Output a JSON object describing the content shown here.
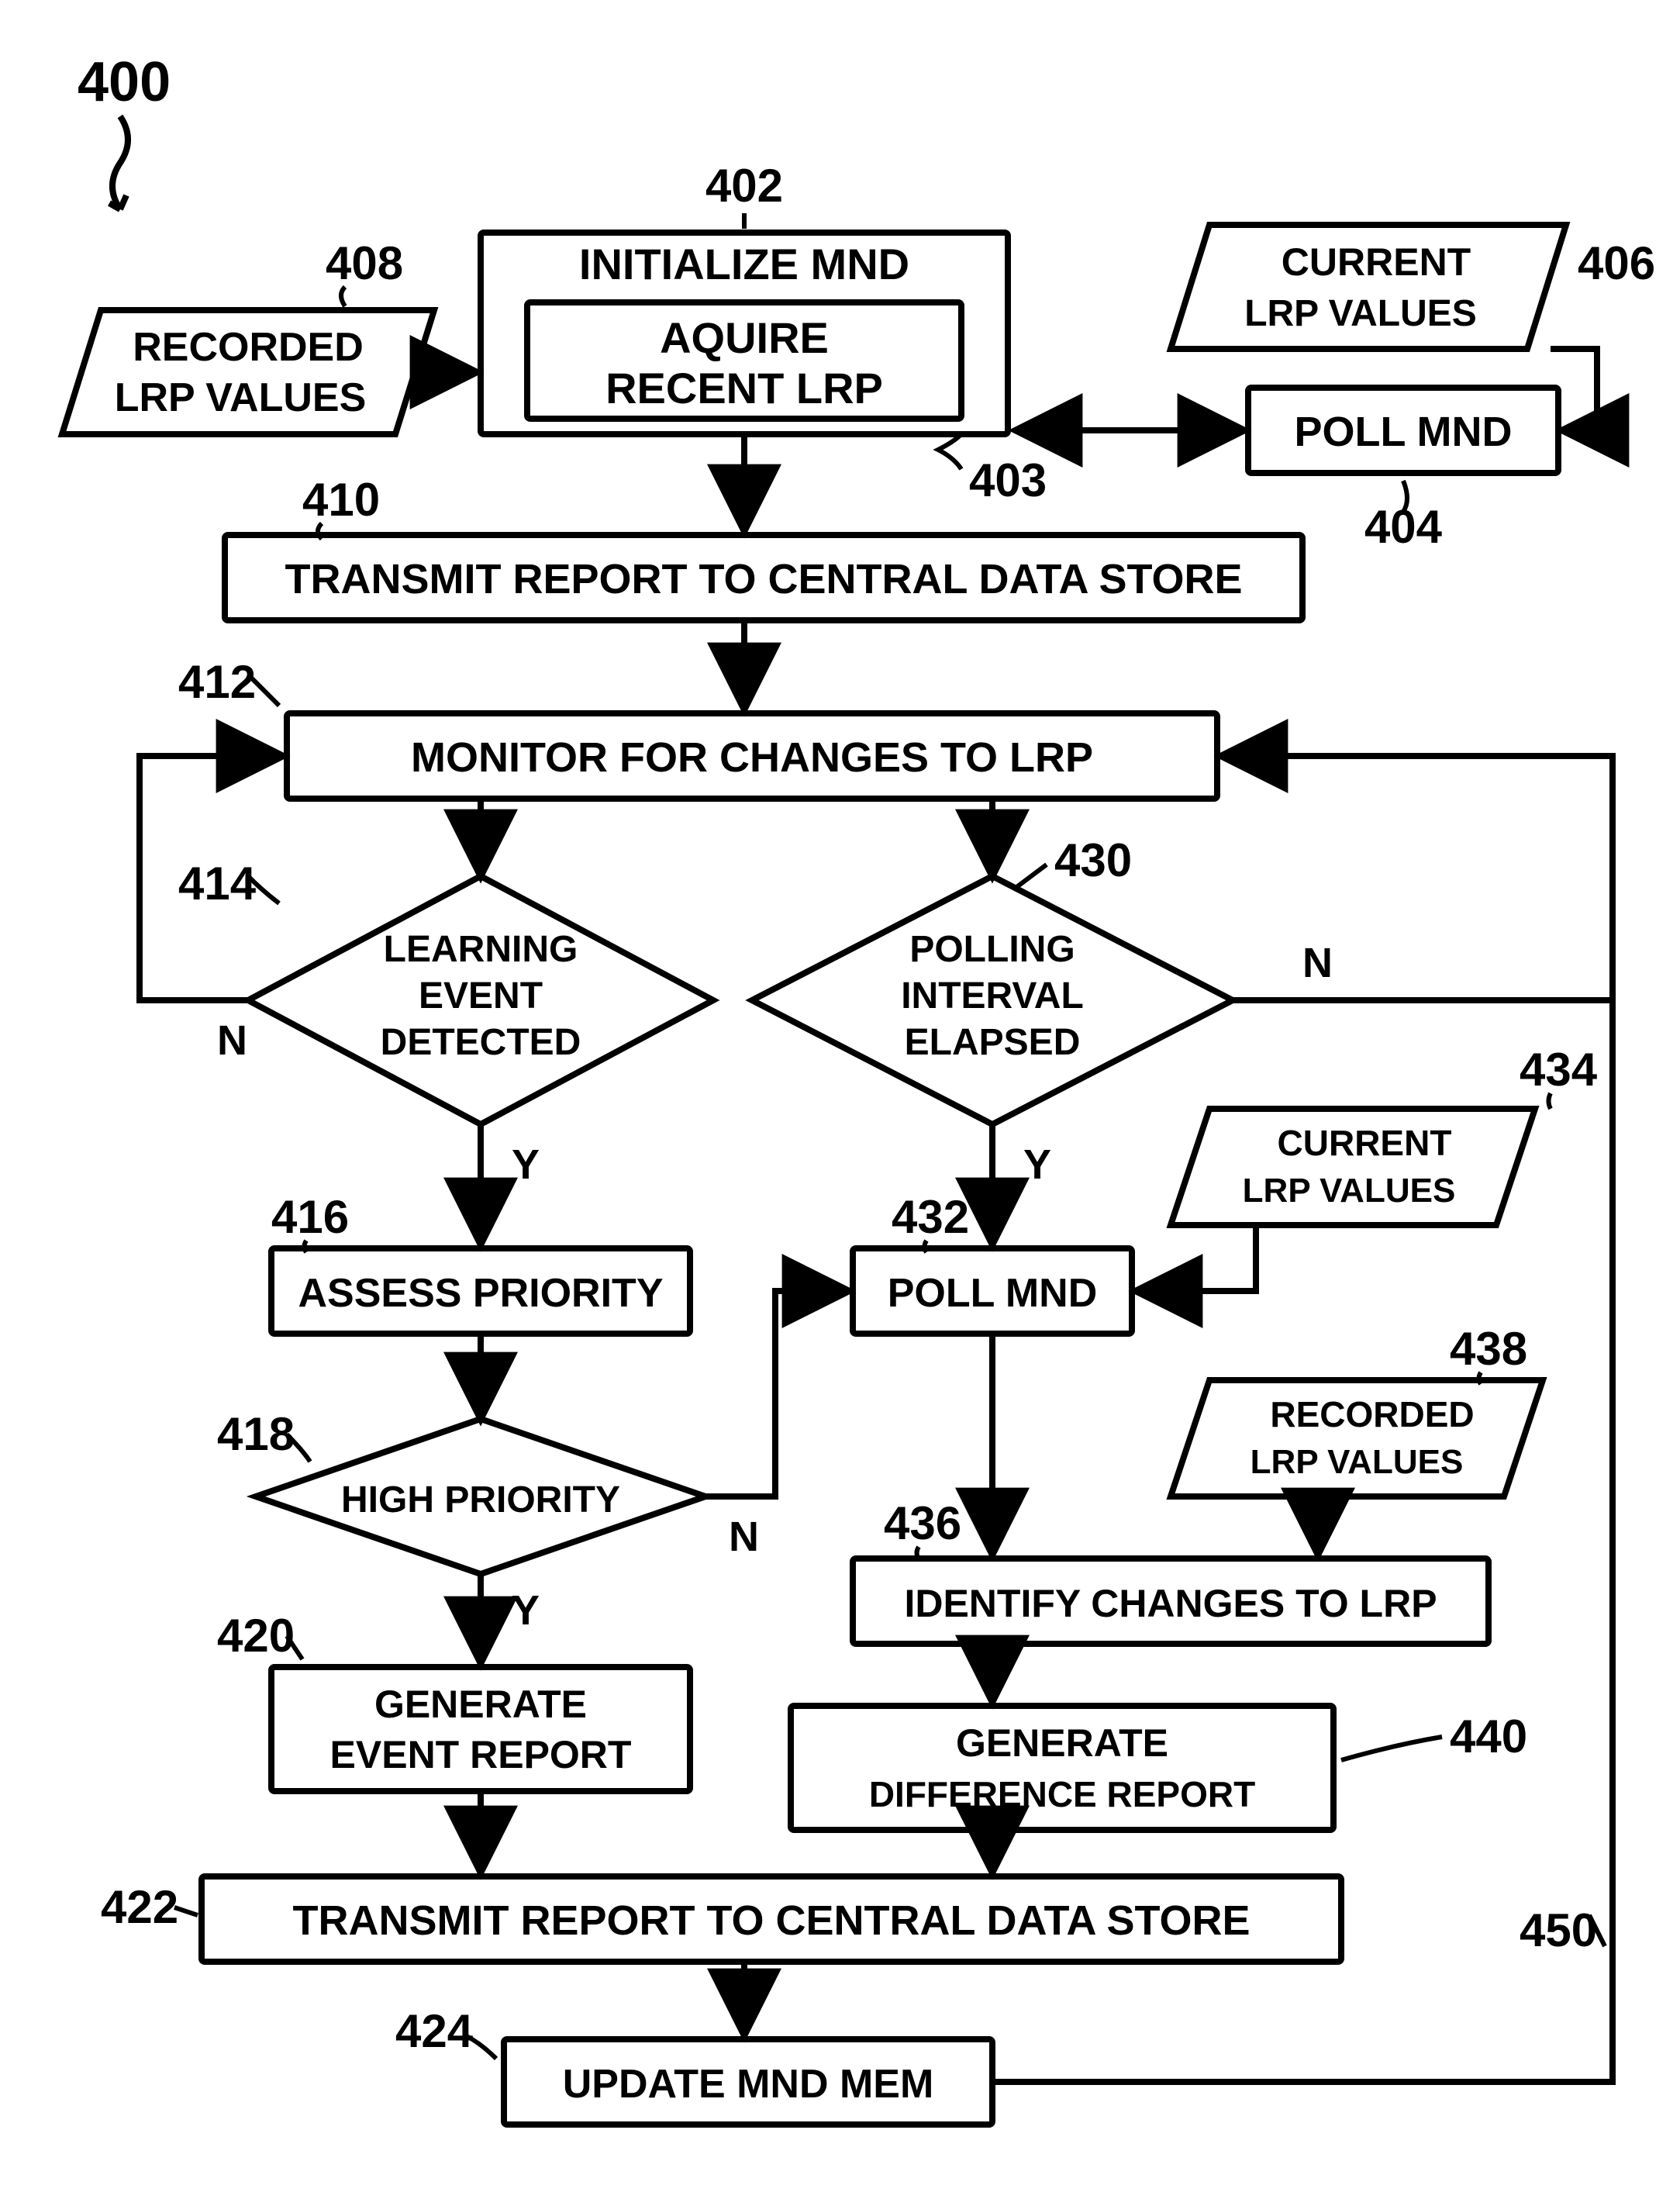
{
  "figureRef": "400",
  "nodes": {
    "n402": {
      "ref": "402",
      "label": "INITIALIZE MND"
    },
    "n403": {
      "ref": "403",
      "label": "AQUIRE RECENT LRP"
    },
    "n404": {
      "ref": "404",
      "label": "POLL MND"
    },
    "n406": {
      "ref": "406",
      "label": "CURRENT LRP VALUES"
    },
    "n408": {
      "ref": "408",
      "label": "RECORDED LRP VALUES"
    },
    "n410": {
      "ref": "410",
      "label": "TRANSMIT REPORT TO CENTRAL DATA STORE"
    },
    "n412": {
      "ref": "412",
      "label": "MONITOR FOR CHANGES TO LRP"
    },
    "n414": {
      "ref": "414",
      "label": "LEARNING EVENT DETECTED"
    },
    "n416": {
      "ref": "416",
      "label": "ASSESS PRIORITY"
    },
    "n418": {
      "ref": "418",
      "label": "HIGH PRIORITY"
    },
    "n420": {
      "ref": "420",
      "label": "GENERATE EVENT REPORT"
    },
    "n422": {
      "ref": "422",
      "label": "TRANSMIT REPORT TO CENTRAL DATA STORE"
    },
    "n424": {
      "ref": "424",
      "label": "UPDATE MND MEM"
    },
    "n430": {
      "ref": "430",
      "label": "POLLING INTERVAL ELAPSED"
    },
    "n432": {
      "ref": "432",
      "label": "POLL MND"
    },
    "n434": {
      "ref": "434",
      "label": "CURRENT LRP VALUES"
    },
    "n436": {
      "ref": "436",
      "label": "IDENTIFY CHANGES TO LRP"
    },
    "n438": {
      "ref": "438",
      "label": "RECORDED LRP VALUES"
    },
    "n440": {
      "ref": "440",
      "label": "GENERATE DIFFERENCE REPORT"
    },
    "n450": {
      "ref": "450"
    }
  },
  "branchLabels": {
    "yes": "Y",
    "no": "N"
  }
}
